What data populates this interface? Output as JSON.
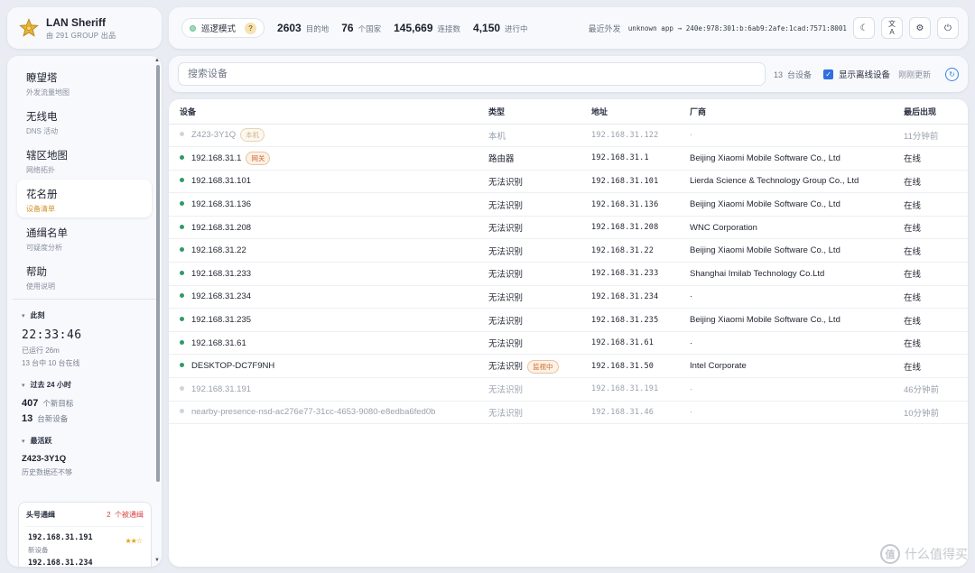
{
  "brand": {
    "title": "LAN Sheriff",
    "subtitle": "由 291 GROUP 出品",
    "icon": "sheriff-star-icon",
    "accent": "#e0a21c"
  },
  "topbar": {
    "mode_label": "巡逻模式",
    "mode_help": "?",
    "stats": [
      {
        "value": "2603",
        "label": "目的地"
      },
      {
        "value": "76",
        "label": "个国家"
      },
      {
        "value": "145,669",
        "label": "连接数"
      },
      {
        "value": "4,150",
        "label": "进行中"
      }
    ],
    "recent_label": "最近外发",
    "recent_value": "unknown app → 240e:978:301:b:6ab9:2afe:1cad:7571:8001",
    "buttons": [
      {
        "name": "theme-toggle-button",
        "icon": "moon-icon",
        "glyph": "☾"
      },
      {
        "name": "language-button",
        "icon": "translate-icon",
        "glyph": "文A"
      },
      {
        "name": "settings-button",
        "icon": "gear-icon",
        "glyph": "⚙"
      },
      {
        "name": "power-button",
        "icon": "power-icon",
        "glyph": "⏻"
      }
    ]
  },
  "sidebar": {
    "items": [
      {
        "label": "瞭望塔",
        "sub": "外发流量地图"
      },
      {
        "label": "无线电",
        "sub": "DNS 活动"
      },
      {
        "label": "辖区地图",
        "sub": "网络拓扑"
      },
      {
        "label": "花名册",
        "sub": "设备清单",
        "active": true
      },
      {
        "label": "通缉名单",
        "sub": "可疑度分析"
      },
      {
        "label": "帮助",
        "sub": "使用说明"
      }
    ],
    "now": {
      "title": "此刻",
      "clock": "22:33:46",
      "uptime": "已运行 26m",
      "online": "13 台中 10 台在线"
    },
    "past24": {
      "title": "过去 24 小时",
      "new_targets": "407",
      "new_targets_label": "个新目标",
      "new_devices": "13",
      "new_devices_label": "台新设备"
    },
    "most_active": {
      "title": "最活跃",
      "name": "Z423-3Y1Q",
      "note": "历史数据还不够"
    },
    "wanted": {
      "title": "头号通缉",
      "count": "2",
      "count_label": "个被通缉",
      "items": [
        {
          "ip": "192.168.31.191",
          "sub": "新设备",
          "stars": "★★☆"
        },
        {
          "ip": "192.168.31.234",
          "sub": "",
          "stars": ""
        }
      ]
    }
  },
  "search": {
    "placeholder": "搜索设备",
    "count": "13",
    "count_label": "台设备",
    "show_offline_label": "显示离线设备",
    "show_offline": true,
    "refresh_label": "刚刚更新"
  },
  "table": {
    "headers": [
      "设备",
      "类型",
      "地址",
      "厂商",
      "最后出现"
    ],
    "rows": [
      {
        "name": "Z423-3Y1Q",
        "tag": "本机",
        "tag_kind": "self",
        "type": "本机",
        "addr": "192.168.31.122",
        "vendor": "·",
        "last": "11分钟前",
        "online": false
      },
      {
        "name": "192.168.31.1",
        "tag": "网关",
        "tag_kind": "gw",
        "type": "路由器",
        "addr": "192.168.31.1",
        "vendor": "Beijing Xiaomi Mobile Software Co., Ltd",
        "last": "在线",
        "online": true
      },
      {
        "name": "192.168.31.101",
        "tag": "",
        "type": "无法识别",
        "addr": "192.168.31.101",
        "vendor": "Lierda Science & Technology Group Co., Ltd",
        "last": "在线",
        "online": true
      },
      {
        "name": "192.168.31.136",
        "tag": "",
        "type": "无法识别",
        "addr": "192.168.31.136",
        "vendor": "Beijing Xiaomi Mobile Software Co., Ltd",
        "last": "在线",
        "online": true
      },
      {
        "name": "192.168.31.208",
        "tag": "",
        "type": "无法识别",
        "addr": "192.168.31.208",
        "vendor": "WNC Corporation",
        "last": "在线",
        "online": true
      },
      {
        "name": "192.168.31.22",
        "tag": "",
        "type": "无法识别",
        "addr": "192.168.31.22",
        "vendor": "Beijing Xiaomi Mobile Software Co., Ltd",
        "last": "在线",
        "online": true
      },
      {
        "name": "192.168.31.233",
        "tag": "",
        "type": "无法识别",
        "addr": "192.168.31.233",
        "vendor": "Shanghai Imilab Technology Co.Ltd",
        "last": "在线",
        "online": true
      },
      {
        "name": "192.168.31.234",
        "tag": "",
        "type": "无法识别",
        "addr": "192.168.31.234",
        "vendor": "·",
        "last": "在线",
        "online": true
      },
      {
        "name": "192.168.31.235",
        "tag": "",
        "type": "无法识别",
        "addr": "192.168.31.235",
        "vendor": "Beijing Xiaomi Mobile Software Co., Ltd",
        "last": "在线",
        "online": true
      },
      {
        "name": "192.168.31.61",
        "tag": "",
        "type": "无法识别",
        "addr": "192.168.31.61",
        "vendor": "·",
        "last": "在线",
        "online": true
      },
      {
        "name": "DESKTOP-DC7F9NH",
        "tag": "",
        "type": "无法识别",
        "type_tag": "监视中",
        "addr": "192.168.31.50",
        "vendor": "Intel Corporate",
        "last": "在线",
        "online": true
      },
      {
        "name": "192.168.31.191",
        "tag": "",
        "type": "无法识别",
        "addr": "192.168.31.191",
        "vendor": "·",
        "last": "46分钟前",
        "online": false
      },
      {
        "name": "nearby-presence-nsd-ac276e77-31cc-4653-9080-e8edba6fed0b",
        "tag": "",
        "type": "无法识别",
        "addr": "192.168.31.46",
        "vendor": "·",
        "last": "10分钟前",
        "online": false
      }
    ]
  },
  "watermark": {
    "text": "什么值得买",
    "glyph": "值"
  }
}
